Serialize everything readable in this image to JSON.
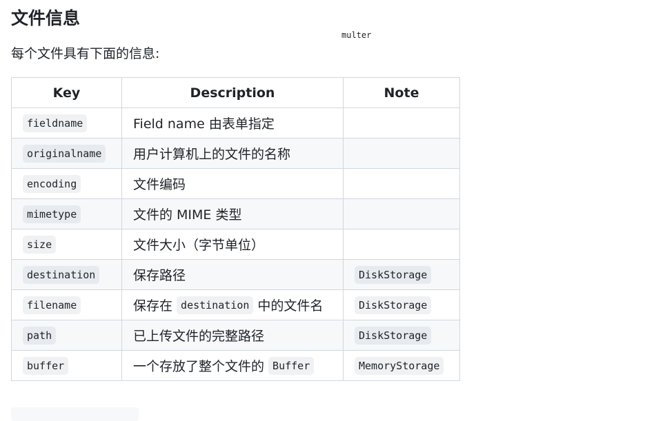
{
  "section": {
    "title": "文件信息",
    "floating_code": "multer",
    "intro": "每个文件具有下面的信息:"
  },
  "table": {
    "headers": {
      "key": "Key",
      "description": "Description",
      "note": "Note"
    },
    "rows": [
      {
        "key": "fieldname",
        "desc": [
          {
            "text": "Field name 由表单指定"
          }
        ],
        "note": ""
      },
      {
        "key": "originalname",
        "desc": [
          {
            "text": "用户计算机上的文件的名称"
          }
        ],
        "note": ""
      },
      {
        "key": "encoding",
        "desc": [
          {
            "text": "文件编码"
          }
        ],
        "note": ""
      },
      {
        "key": "mimetype",
        "desc": [
          {
            "text": "文件的 MIME 类型"
          }
        ],
        "note": ""
      },
      {
        "key": "size",
        "desc": [
          {
            "text": "文件大小（字节单位）"
          }
        ],
        "note": ""
      },
      {
        "key": "destination",
        "desc": [
          {
            "text": "保存路径"
          }
        ],
        "note": "DiskStorage"
      },
      {
        "key": "filename",
        "desc": [
          {
            "text": "保存在 "
          },
          {
            "code": "destination"
          },
          {
            "text": " 中的文件名"
          }
        ],
        "note": "DiskStorage"
      },
      {
        "key": "path",
        "desc": [
          {
            "text": "已上传文件的完整路径"
          }
        ],
        "note": "DiskStorage"
      },
      {
        "key": "buffer",
        "desc": [
          {
            "text": "一个存放了整个文件的 "
          },
          {
            "code": "Buffer"
          }
        ],
        "note": "MemoryStorage"
      }
    ]
  }
}
